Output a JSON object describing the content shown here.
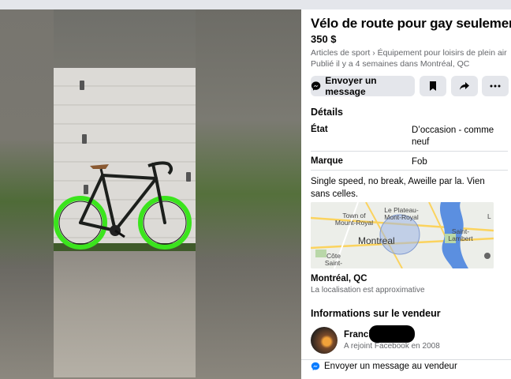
{
  "listing": {
    "title": "Vélo de route pour gay seulement",
    "price": "350 $",
    "breadcrumb": "Articles de sport › Équipement pour loisirs de plein air",
    "posted": "Publié il y a 4 semaines dans Montréal, QC"
  },
  "actions": {
    "message_label": "Envoyer un message"
  },
  "details": {
    "heading": "Détails",
    "condition_label": "État",
    "condition_value": "D’occasion - comme neuf",
    "brand_label": "Marque",
    "brand_value": "Fob",
    "description": "Single speed, no break, Aweille par la. Vien sans celles."
  },
  "map": {
    "labels": {
      "town_of_mount_royal": "Town of Mount-Royal",
      "plateau": "Le Plateau-Mont-Royal",
      "montreal": "Montreal",
      "saint_lambert": "Saint-Lambert",
      "cote_saint": "Côte Saint-",
      "edge": "L"
    }
  },
  "location": {
    "city": "Montréal, QC",
    "note": "La localisation est approximative"
  },
  "seller": {
    "heading": "Informations sur le vendeur",
    "name": "Francis",
    "joined": "A rejoint Facebook en 2008",
    "message_label": "Envoyer un message au vendeur"
  },
  "colors": {
    "button_bg": "#e4e6eb",
    "secondary_text": "#65676b",
    "messenger_blue": "#0a7cff",
    "bike_wheel_green": "#39e61b"
  },
  "icons": {
    "messenger": "messenger-icon",
    "save": "bookmark-icon",
    "share": "share-icon",
    "more": "more-icon"
  }
}
